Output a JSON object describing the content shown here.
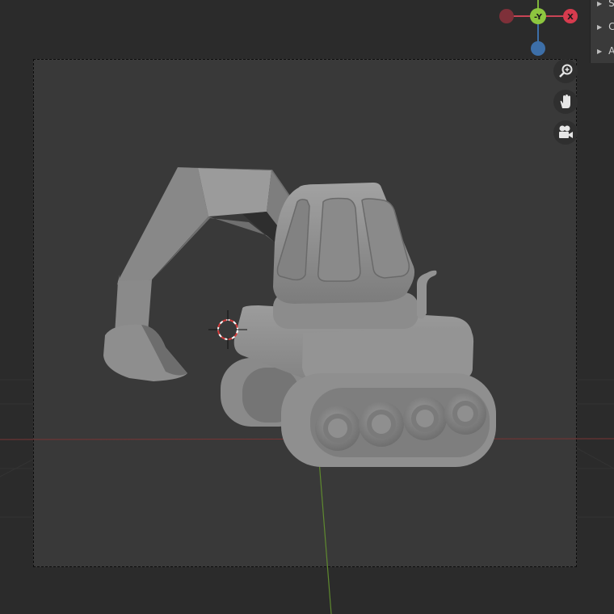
{
  "viewport": {
    "background": "#2b2b2b",
    "camera_frame_color": "#393939"
  },
  "gizmo": {
    "neg_y_label": "-Y",
    "x_label": "X",
    "colors": {
      "x": "#d63b4e",
      "y": "#8dc63f",
      "z": "#3d6fa8",
      "neg_x": "#7e3039"
    }
  },
  "navigation": {
    "zoom": "zoom-icon",
    "pan": "hand-pan-icon",
    "camera": "camera-view-icon"
  },
  "side_panel": {
    "items": [
      {
        "label": "S"
      },
      {
        "label": "C"
      },
      {
        "label": "A"
      }
    ]
  },
  "model": {
    "color": "#8c8c8c"
  }
}
